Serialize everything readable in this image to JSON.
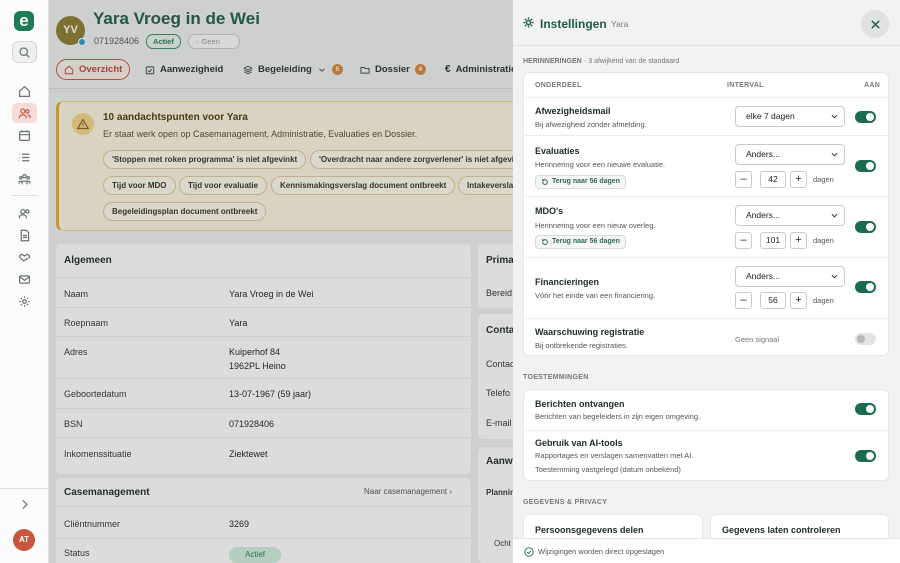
{
  "patient": {
    "initials": "YV",
    "name": "Yara Vroeg in de Wei",
    "id": "071928406",
    "status": "Actief",
    "tag": "Geen"
  },
  "tabs": [
    {
      "label": "Overzicht",
      "icon": "grid-icon"
    },
    {
      "label": "Aanwezigheid",
      "icon": "calendar-check-icon"
    },
    {
      "label": "Begeleiding",
      "icon": "layers-icon",
      "count": "5"
    },
    {
      "label": "Dossier",
      "icon": "folder-icon",
      "count": "4"
    },
    {
      "label": "Administratie",
      "icon": "euro-icon"
    }
  ],
  "alert": {
    "title": "10 aandachtspunten voor Yara",
    "subtitle": "Er staat werk open op Casemanagement, Administratie, Evaluaties en Dossier.",
    "chips": [
      "'Stoppen met roken programma' is niet afgevinkt",
      "'Overdracht naar andere zorgverlener' is niet afgevinkt",
      "Tijd voor MDO",
      "Tijd voor evaluatie",
      "Kennismakingsverslag document ontbreekt",
      "Intakeverslag document ontbreekt",
      "Begeleidingsplan document ontbreekt"
    ]
  },
  "algemeen": {
    "title": "Algemeen",
    "rows": [
      {
        "label": "Naam",
        "value": "Yara Vroeg in de Wei"
      },
      {
        "label": "Roepnaam",
        "value": "Yara"
      },
      {
        "label": "Adres",
        "value": "Kuiperhof 84",
        "value2": "1962PL Heino"
      },
      {
        "label": "Geboortedatum",
        "value": "13-07-1967 (59 jaar)"
      },
      {
        "label": "BSN",
        "value": "071928406"
      },
      {
        "label": "Inkomenssituatie",
        "value": "Ziektewet"
      }
    ]
  },
  "casemanagement": {
    "title": "Casemanagement",
    "link": "Naar casemanagement",
    "rows": [
      {
        "label": "Cliëntnummer",
        "value": "3269"
      },
      {
        "label": "Status",
        "value": "Actief"
      }
    ]
  },
  "right_cards": {
    "prima": "Prima",
    "bereid": "Bereid",
    "conta": "Conta",
    "contac": "Contac",
    "telefo": "Telefo",
    "email": "E-mail",
    "aanw": "Aanw",
    "plann": "Plannin",
    "ocht": "Ocht"
  },
  "panel": {
    "title": "Instellingen",
    "subtitle": "Yara",
    "sections": {
      "herinneringen": "HERINNERINGEN",
      "herinneringen_note": "· 3 afwijkend van de standaard",
      "toestemmingen": "TOESTEMMINGEN",
      "privacy": "GEGEVENS & PRIVACY"
    },
    "columns": {
      "onderdeel": "ONDERDEEL",
      "interval": "INTERVAL",
      "aan": "AAN"
    },
    "reminders": [
      {
        "title": "Afwezigheidsmail",
        "desc": "Bij afwezigheid zonder afmelding.",
        "select": "elke 7 dagen",
        "enabled": true
      },
      {
        "title": "Evaluaties",
        "desc": "Herinnering voor een nieuwe evaluatie.",
        "reset": "Terug naar 56 dagen",
        "select": "Anders...",
        "stepper": "42",
        "unit": "dagen",
        "enabled": true
      },
      {
        "title": "MDO's",
        "desc": "Herinnering voor een nieuw overleg.",
        "reset": "Terug naar 56 dagen",
        "select": "Anders...",
        "stepper": "101",
        "unit": "dagen",
        "enabled": true
      },
      {
        "title": "Financieringen",
        "desc": "Vóór het einde van een financiering.",
        "select": "Anders...",
        "stepper": "56",
        "unit": "dagen",
        "enabled": true
      },
      {
        "title": "Waarschuwing registratie",
        "desc": "Bij ontbrekende registraties.",
        "signal": "Geen signaal",
        "enabled": false
      }
    ],
    "permissions": [
      {
        "title": "Berichten ontvangen",
        "desc": "Berichten van begeleiders in zijn eigen omgeving.",
        "enabled": true
      },
      {
        "title": "Gebruik van AI-tools",
        "desc": "Rapportages en verslagen samenvatten met AI.",
        "desc2": "Toestemming vastgelegd (datum onbekend)",
        "enabled": true
      }
    ],
    "privacy_cards": [
      "Persoonsgegevens delen",
      "Gegevens laten controleren"
    ],
    "footer": "Wijzigingen worden direct opgeslagen"
  },
  "user": {
    "initials": "AT"
  },
  "colors": {
    "brand": "#1d7a56",
    "accent": "#c8563f",
    "toggle_on": "#1d6b4f",
    "warning": "#e0a935"
  }
}
